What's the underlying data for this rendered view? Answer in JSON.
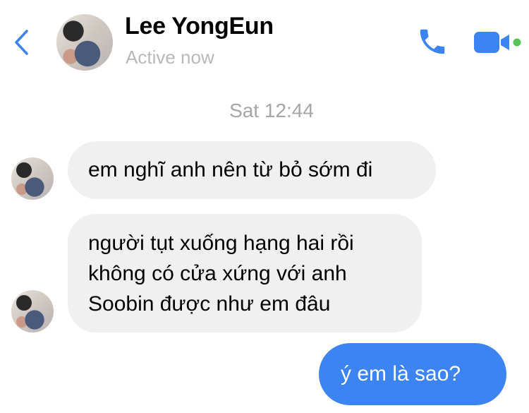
{
  "header": {
    "name": "Lee YongEun",
    "status": "Active now"
  },
  "conversation": {
    "timestamp": "Sat 12:44",
    "messages": [
      {
        "sender": "contact",
        "text": "em nghĩ anh nên từ bỏ sớm đi"
      },
      {
        "sender": "contact",
        "text": "người tụt xuống hạng hai rồi\nkhông có cửa xứng với anh\nSoobin được như em đâu"
      },
      {
        "sender": "me",
        "text": "ý em là sao?"
      }
    ]
  },
  "colors": {
    "accent": "#3b84f2",
    "incoming_bubble": "#f0f0f0",
    "online_dot": "#5ac25a",
    "muted_text": "#a6a6aa"
  },
  "icons": [
    "chevron-left-icon",
    "phone-icon",
    "video-camera-icon"
  ]
}
